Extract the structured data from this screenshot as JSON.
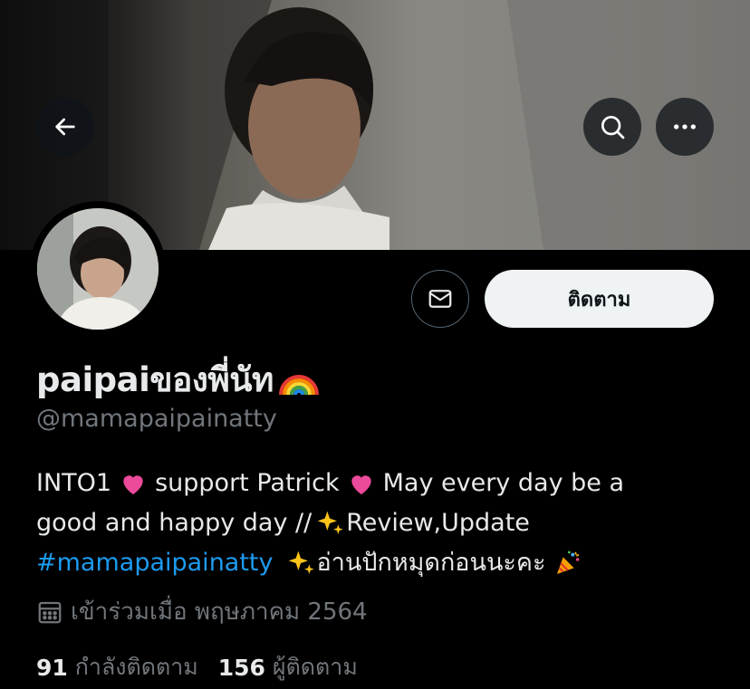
{
  "header": {
    "back_icon": "arrow-left-icon",
    "search_icon": "search-icon",
    "more_icon": "more-horizontal-icon"
  },
  "actions": {
    "message_icon": "mail-icon",
    "follow_label": "ติดตาม"
  },
  "profile": {
    "display_name": "paipaiของพี่นัท",
    "name_emoji": "rainbow-emoji",
    "handle": "@mamapaipainatty"
  },
  "bio": {
    "line1_a": "INTO1",
    "line1_b": "support Patrick",
    "line1_c": "May every day be a",
    "line2_a": "good and happy day //",
    "line2_b": "Review,Update",
    "hashtag": "#mamapaipainatty",
    "line3_b": "อ่านปักหมุดก่อนนะคะ",
    "emojis": [
      "pink-heart-emoji",
      "sparkles-emoji",
      "party-popper-emoji"
    ]
  },
  "joined": {
    "icon": "calendar-icon",
    "text": "เข้าร่วมเมื่อ พฤษภาคม 2564"
  },
  "stats": {
    "following_count": "91",
    "following_label": "กำลังติดตาม",
    "followers_count": "156",
    "followers_label": "ผู้ติดตาม"
  },
  "colors": {
    "background": "#000000",
    "text_primary": "#e7e9ea",
    "text_secondary": "#71767b",
    "link": "#1d9bf0",
    "follow_button_bg": "#eff3f4"
  }
}
